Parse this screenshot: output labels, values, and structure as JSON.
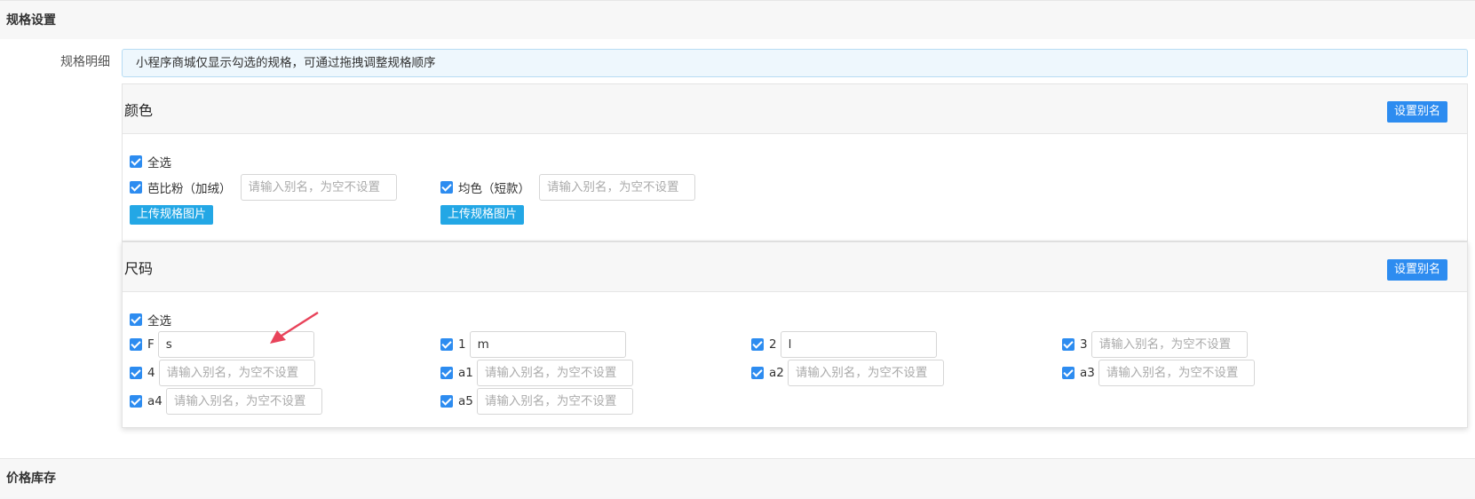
{
  "sections": {
    "spec_title": "规格设置",
    "price_title": "价格库存"
  },
  "spec_detail": {
    "label": "规格明细",
    "notice": "小程序商城仅显示勾选的规格，可通过拖拽调整规格顺序"
  },
  "color_group": {
    "title": "颜色",
    "alias_button": "设置别名",
    "select_all": "全选",
    "upload_label": "上传规格图片",
    "items": [
      {
        "label": "芭比粉（加绒）",
        "value": "",
        "placeholder": "请输入别名，为空不设置"
      },
      {
        "label": "均色（短款）",
        "value": "",
        "placeholder": "请输入别名，为空不设置"
      }
    ]
  },
  "size_group": {
    "title": "尺码",
    "alias_button": "设置别名",
    "select_all": "全选",
    "items": [
      {
        "label": "F",
        "value": "s",
        "placeholder": "请输入别名，为空不设置"
      },
      {
        "label": "1",
        "value": "m",
        "placeholder": "请输入别名，为空不设置"
      },
      {
        "label": "2",
        "value": "l",
        "placeholder": "请输入别名，为空不设置"
      },
      {
        "label": "3",
        "value": "",
        "placeholder": "请输入别名，为空不设置"
      },
      {
        "label": "4",
        "value": "",
        "placeholder": "请输入别名，为空不设置"
      },
      {
        "label": "a1",
        "value": "",
        "placeholder": "请输入别名，为空不设置"
      },
      {
        "label": "a2",
        "value": "",
        "placeholder": "请输入别名，为空不设置"
      },
      {
        "label": "a3",
        "value": "",
        "placeholder": "请输入别名，为空不设置"
      },
      {
        "label": "a4",
        "value": "",
        "placeholder": "请输入别名，为空不设置"
      },
      {
        "label": "a5",
        "value": "",
        "placeholder": "请输入别名，为空不设置"
      }
    ]
  },
  "colors": {
    "primary_button": "#2d8cf0",
    "upload_button": "#23a7e5",
    "checkbox": "#2d8cf0",
    "arrow": "#e8435a"
  }
}
